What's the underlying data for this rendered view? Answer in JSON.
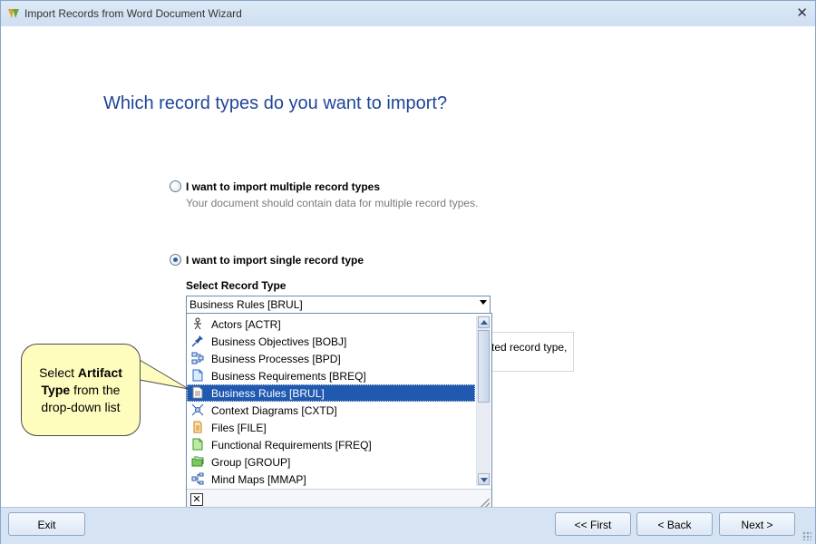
{
  "window": {
    "title": "Import Records from Word Document Wizard"
  },
  "heading": "Which record types do you want to import?",
  "options": {
    "multiple": {
      "label": "I want to import multiple record types",
      "description": "Your document should contain data for multiple record types.",
      "checked": false
    },
    "single": {
      "label": "I want to import single record type",
      "checked": true
    }
  },
  "select": {
    "label": "Select Record Type",
    "value": "Business Rules [BRUL]",
    "items": [
      {
        "label": "Actors [ACTR]",
        "icon": "actor-icon"
      },
      {
        "label": "Business Objectives [BOBJ]",
        "icon": "pushpin-icon"
      },
      {
        "label": "Business Processes [BPD]",
        "icon": "process-diagram-icon"
      },
      {
        "label": "Business Requirements [BREQ]",
        "icon": "requirement-doc-icon"
      },
      {
        "label": "Business Rules [BRUL]",
        "icon": "rules-doc-icon",
        "selected": true
      },
      {
        "label": "Context Diagrams [CXTD]",
        "icon": "context-diagram-icon"
      },
      {
        "label": "Files [FILE]",
        "icon": "file-icon"
      },
      {
        "label": "Functional Requirements [FREQ]",
        "icon": "functional-doc-icon"
      },
      {
        "label": "Group [GROUP]",
        "icon": "group-icon"
      },
      {
        "label": "Mind Maps [MMAP]",
        "icon": "mind-map-icon"
      }
    ]
  },
  "info_text": "ted record type,",
  "callout": {
    "pre": "Select ",
    "bold1": "Artifact",
    "bold2": "Type",
    "post1": " from the",
    "post2": "drop-down list"
  },
  "buttons": {
    "exit": "Exit",
    "first": "<< First",
    "back": "< Back",
    "next": "Next >"
  },
  "colors": {
    "accent": "#1e4598",
    "selection": "#1f59b0",
    "callout_bg": "#fffdbd"
  }
}
